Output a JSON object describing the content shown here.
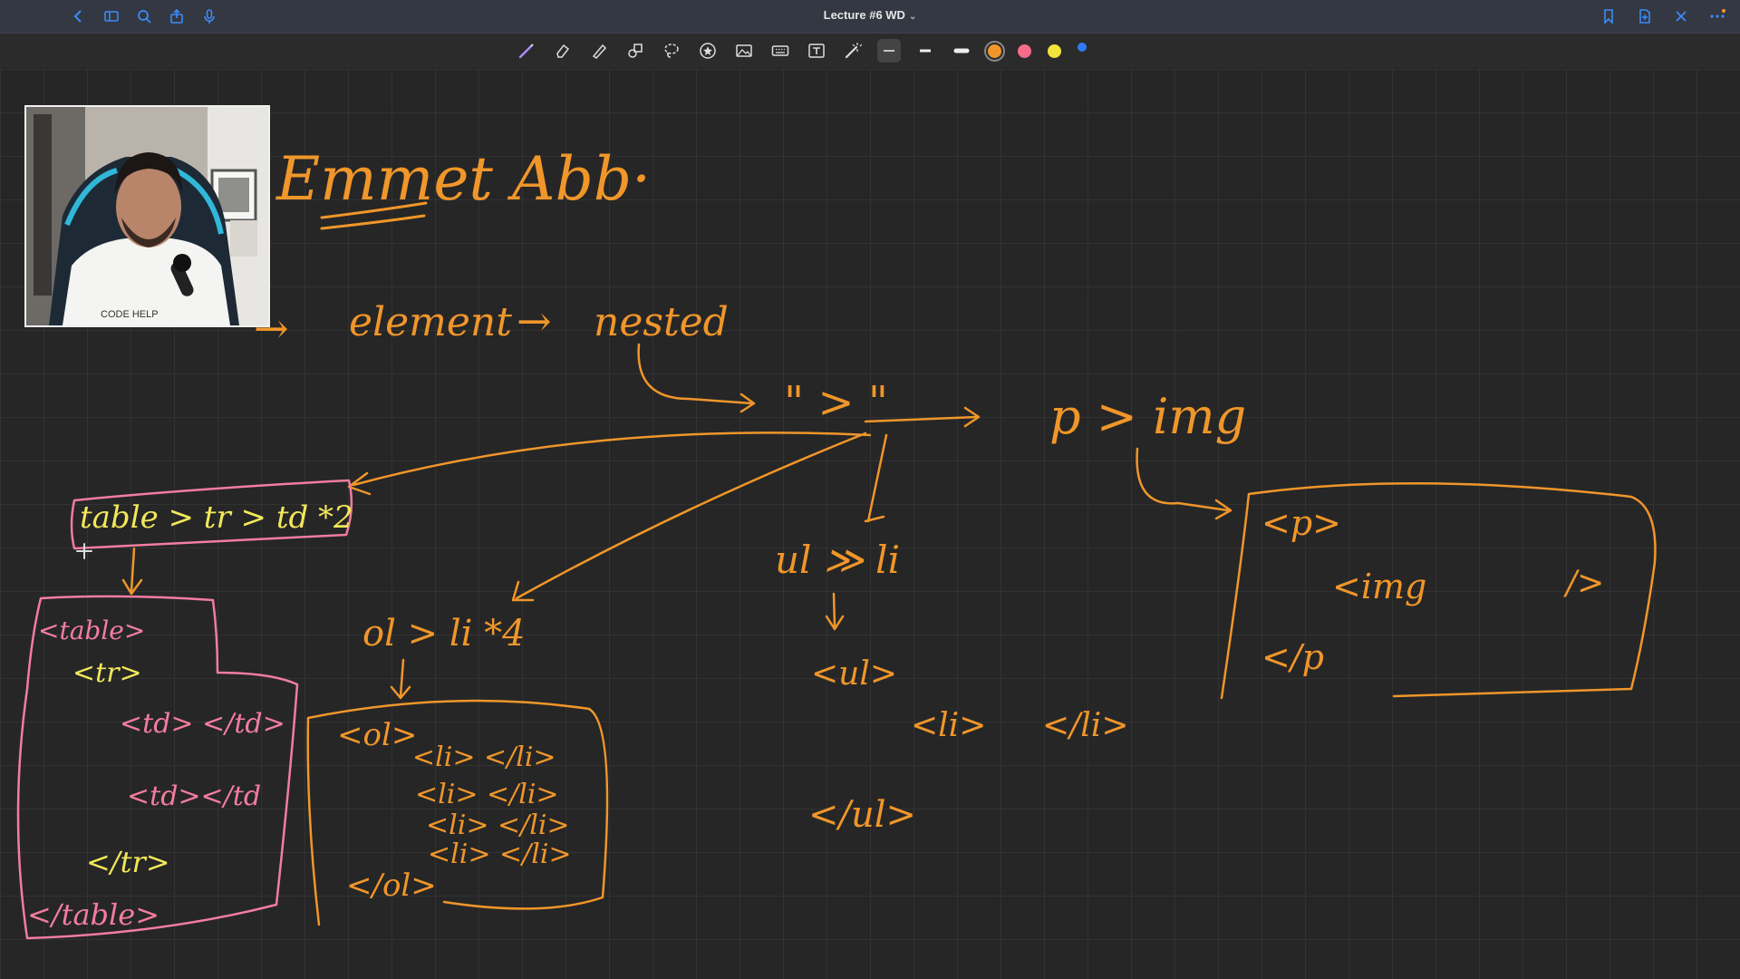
{
  "window": {
    "title": "Lecture #6 WD"
  },
  "toolbar": {
    "left_icons": [
      "back-icon",
      "sidebar-icon",
      "search-icon",
      "share-icon",
      "microphone-icon"
    ],
    "right_icons": [
      "bookmark-icon",
      "new-page-icon",
      "close-icon",
      "more-icon"
    ],
    "tools": [
      "pen-icon",
      "eraser-icon",
      "highlighter-icon",
      "shapes-icon",
      "lasso-icon",
      "sticker-icon",
      "image-icon",
      "keyboard-icon",
      "text-box-icon",
      "laser-pointer-icon"
    ],
    "stroke_widths": [
      "thin",
      "medium",
      "thick"
    ],
    "colors": [
      "#f0962a",
      "#f56b8a",
      "#f2e43a",
      "#2f7cf6"
    ],
    "selected_color": "#f0962a"
  },
  "webcam": {
    "shirt_text": "CODE HELP"
  },
  "ink": {
    "color": "#f0962a",
    "highlight_color": "#f27da0",
    "yellow_color": "#f2e85a",
    "heading": "Emmet  Abb·",
    "row1": [
      "→",
      "element",
      "→",
      "nested"
    ],
    "child_op": "\" > \"",
    "p_img": "p > img",
    "table_abbr": "table > tr > td *2",
    "ol_abbr": "ol > li *4",
    "ul_abbr": "ul ≫ li",
    "table_tags": [
      "<table>",
      "<tr>",
      "<td> </td>",
      "<td></td",
      "</tr>",
      "</table>"
    ],
    "ol_tags": [
      "<ol>",
      "<li> </li>",
      "<li> </li>",
      "<li> </li>",
      "<li> </li>",
      "</ol>"
    ],
    "ul_tags": [
      "<ul>",
      "<li>",
      "</li>",
      "</ul>"
    ],
    "p_tags": [
      "<p>",
      "<img",
      "/>",
      "</p"
    ]
  }
}
